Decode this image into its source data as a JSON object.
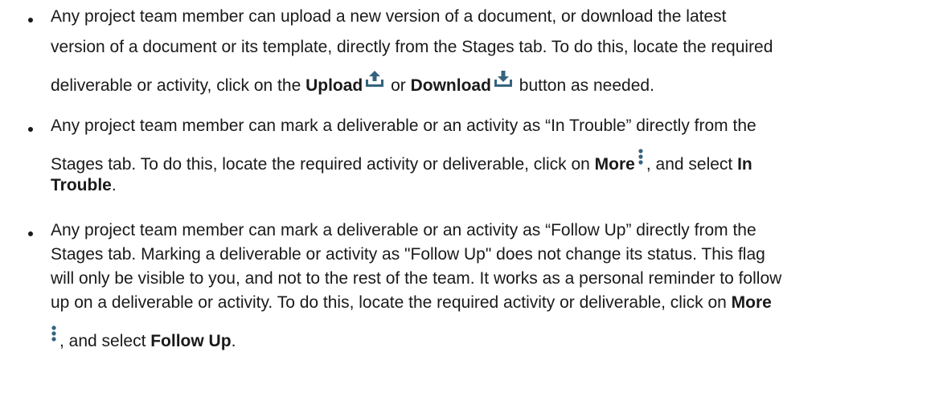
{
  "colors": {
    "text": "#1a1a1a",
    "icon": "#35637f"
  },
  "icons": {
    "upload": "upload-arrow-tray-icon",
    "download": "download-arrow-tray-icon",
    "more": "vertical-ellipsis-more-icon"
  },
  "bullets": [
    {
      "line1": "Any project team member can upload a new version of a document, or download the latest",
      "line2": "version of a document or its template, directly from the Stages tab. To do this, locate the required",
      "line3_pre": "deliverable or activity, click on the ",
      "upload_label": "Upload",
      "or_word": " or ",
      "download_label": "Download",
      "line3_post": " button as needed."
    },
    {
      "line1": "Any project team member can mark a deliverable or an activity as “In Trouble” directly from the",
      "line2_pre": "Stages tab. To do this, locate the required activity or deliverable, click on ",
      "more_label": "More",
      "line2_mid": ", and select ",
      "in_label": "In",
      "trouble_label": "Trouble",
      "line3_post": "."
    },
    {
      "line1": "Any project team member can mark a deliverable or an activity as “Follow Up” directly from the",
      "line2": "Stages tab. Marking a deliverable or activity as \"Follow Up\" does not change its status. This flag",
      "line3": "will only be visible to you, and not to the rest of the team. It works as a personal reminder to follow",
      "line4_pre": "up on a deliverable or activity. To do this, locate the required activity or deliverable, click on ",
      "more_label": "More",
      "line5_mid": ", and select ",
      "follow_label": "Follow Up",
      "line5_post": "."
    }
  ]
}
